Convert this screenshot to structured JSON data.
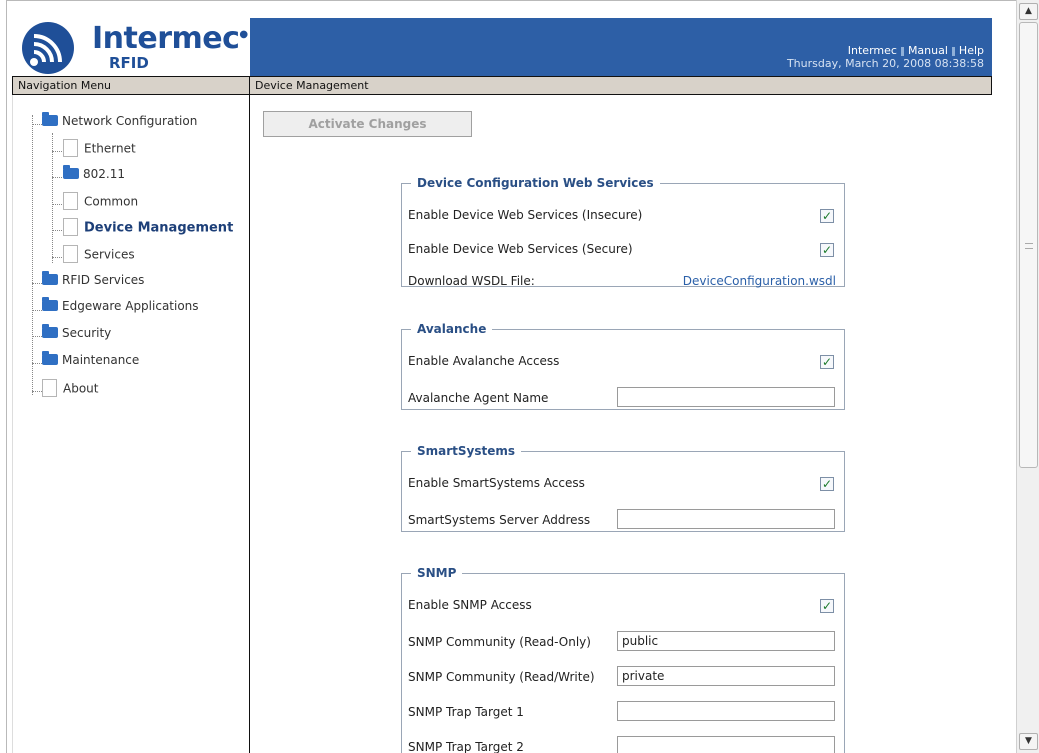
{
  "header": {
    "brand_name": "Intermec",
    "brand_sub": "RFID",
    "links": [
      "Intermec",
      "Manual",
      "Help"
    ],
    "datetime": "Thursday, March 20, 2008 08:38:58"
  },
  "nav_bar_title": "Navigation Menu",
  "content_bar_title": "Device Management",
  "nav": {
    "items": [
      {
        "label": "Network Configuration",
        "icon": "folder-icon"
      },
      {
        "label": "Ethernet",
        "icon": "page-icon"
      },
      {
        "label": "802.11",
        "icon": "folder-icon"
      },
      {
        "label": "Common",
        "icon": "page-icon"
      },
      {
        "label": "Device Management",
        "icon": "page-icon"
      },
      {
        "label": "Services",
        "icon": "page-icon"
      },
      {
        "label": "RFID Services",
        "icon": "folder-icon"
      },
      {
        "label": "Edgeware Applications",
        "icon": "folder-icon"
      },
      {
        "label": "Security",
        "icon": "folder-icon"
      },
      {
        "label": "Maintenance",
        "icon": "folder-icon"
      },
      {
        "label": "About",
        "icon": "page-icon"
      }
    ],
    "active": "Device Management"
  },
  "activate_button": "Activate Changes",
  "groups": {
    "dcws": {
      "legend": "Device Configuration Web Services",
      "insecure_label": "Enable Device Web Services (Insecure)",
      "insecure_checked": true,
      "secure_label": "Enable Device Web Services (Secure)",
      "secure_checked": true,
      "wsdl_label": "Download WSDL File:",
      "wsdl_link": "DeviceConfiguration.wsdl"
    },
    "avalanche": {
      "legend": "Avalanche",
      "access_label": "Enable Avalanche Access",
      "access_checked": true,
      "agent_label": "Avalanche Agent Name",
      "agent_value": ""
    },
    "smartsystems": {
      "legend": "SmartSystems",
      "access_label": "Enable SmartSystems Access",
      "access_checked": true,
      "server_label": "SmartSystems Server Address",
      "server_value": ""
    },
    "snmp": {
      "legend": "SNMP",
      "access_label": "Enable SNMP Access",
      "access_checked": true,
      "ro_label": "SNMP Community (Read-Only)",
      "ro_value": "public",
      "rw_label": "SNMP Community (Read/Write)",
      "rw_value": "private",
      "trap1_label": "SNMP Trap Target 1",
      "trap1_value": "",
      "trap2_label": "SNMP Trap Target 2",
      "trap2_value": ""
    }
  },
  "checkmark": "✓",
  "colors": {
    "header_blue": "#2d5fa6",
    "bar_tan": "#d8d2c9",
    "legend_blue": "#2a4f85",
    "link_blue": "#2a5fa8",
    "folder_blue": "#2f6fc3"
  }
}
